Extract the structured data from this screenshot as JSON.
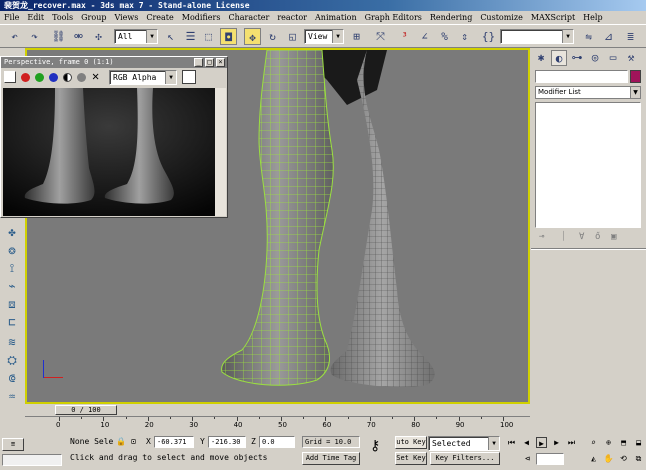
{
  "window": {
    "title": "裴贺龙_recover.max - 3ds max 7 - Stand-alone License"
  },
  "menu": [
    "File",
    "Edit",
    "Tools",
    "Group",
    "Views",
    "Create",
    "Modifiers",
    "Character",
    "reactor",
    "Animation",
    "Graph Editors",
    "Rendering",
    "Customize",
    "MAXScript",
    "Help"
  ],
  "toolbar": {
    "selection_filter": "All",
    "reference_coord": "View"
  },
  "render_window": {
    "title": "Perspective, frame 0 (1:1)",
    "channel": "RGB Alpha"
  },
  "command_panel": {
    "modifier_list": "Modifier List",
    "object_color": "#a0145a"
  },
  "timeline": {
    "frame_display": "0 / 100",
    "ruler_labels": [
      "0",
      "10",
      "20",
      "30",
      "40",
      "50",
      "60",
      "70",
      "80",
      "90",
      "100"
    ]
  },
  "status": {
    "selection": "None Sele",
    "x_label": "X",
    "x_value": "-60.371",
    "y_label": "Y",
    "y_value": "-216.30",
    "z_label": "Z",
    "z_value": "0.0",
    "grid": "Grid = 10.0",
    "prompt": "Click and drag to select and move objects",
    "add_time_tag": "Add Time Tag",
    "auto_key": "uto Key",
    "key_mode": "Selected",
    "set_key": "Set Key",
    "key_filters": "Key Filters..."
  },
  "colors": {
    "viewport_bg": "#7a7a7a",
    "wireframe": "#9be040",
    "active_border": "#d0d000",
    "titlebar": "#0a246a"
  }
}
